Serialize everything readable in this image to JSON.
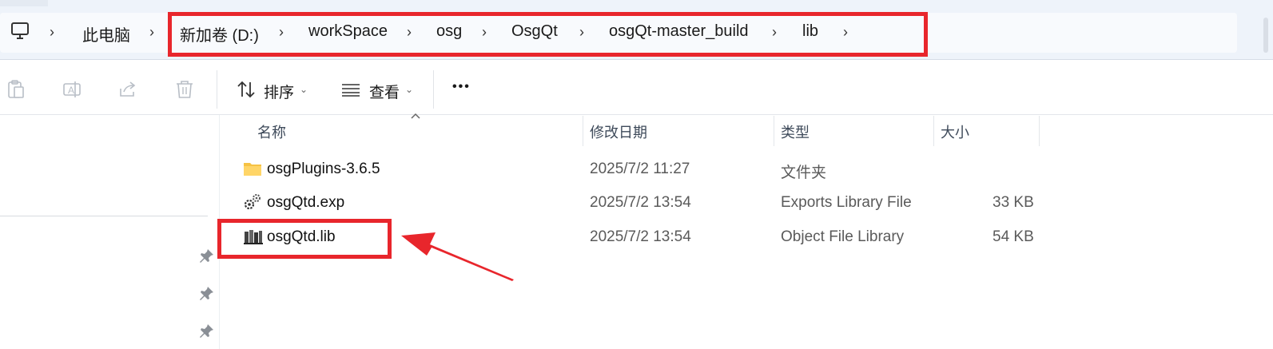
{
  "breadcrumb": {
    "items": [
      "此电脑",
      "新加卷 (D:)",
      "workSpace",
      "osg",
      "OsgQt",
      "osgQt-master_build",
      "lib"
    ]
  },
  "toolbar": {
    "sort_label": "排序",
    "view_label": "查看",
    "more_label": "•••"
  },
  "columns": {
    "name": "名称",
    "modified": "修改日期",
    "type": "类型",
    "size": "大小"
  },
  "files": [
    {
      "name": "osgPlugins-3.6.5",
      "modified": "2025/7/2 11:27",
      "type": "文件夹",
      "size": "",
      "icon": "folder-icon"
    },
    {
      "name": "osgQtd.exp",
      "modified": "2025/7/2 13:54",
      "type": "Exports Library File",
      "size": "33 KB",
      "icon": "exp-file-icon"
    },
    {
      "name": "osgQtd.lib",
      "modified": "2025/7/2 13:54",
      "type": "Object File Library",
      "size": "54 KB",
      "icon": "lib-file-icon"
    }
  ],
  "colors": {
    "highlight": "#e8262c",
    "address_bar": "#eef3fa"
  }
}
